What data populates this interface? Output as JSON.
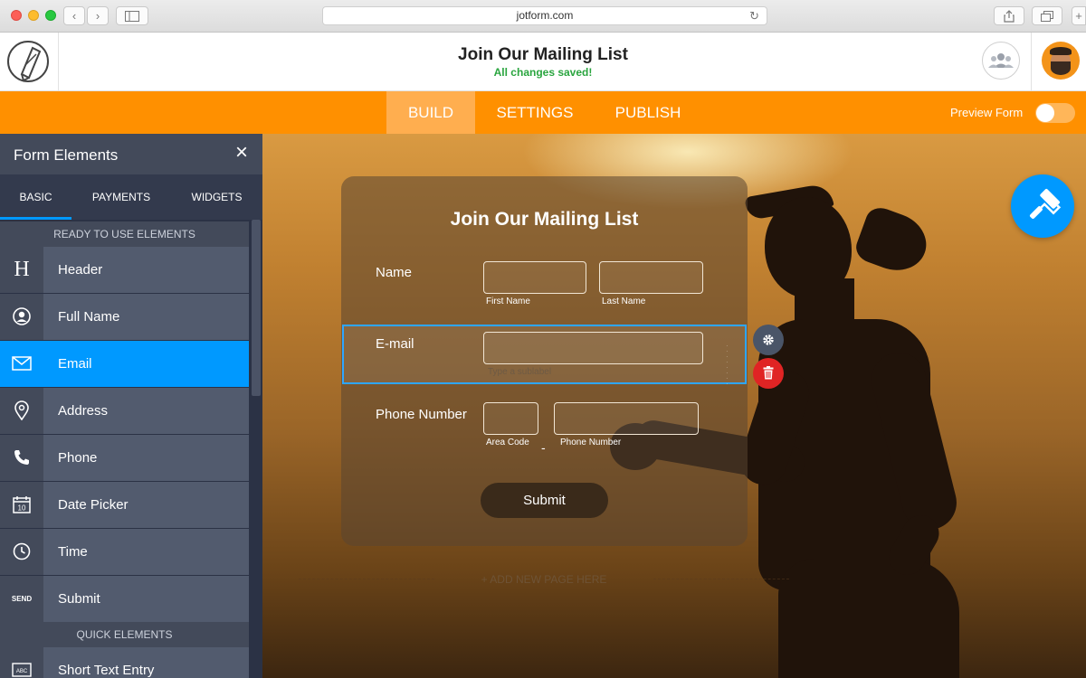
{
  "browser": {
    "url": "jotform.com"
  },
  "header": {
    "title": "Join Our Mailing List",
    "status": "All changes saved!"
  },
  "nav": {
    "tabs": [
      {
        "label": "BUILD"
      },
      {
        "label": "SETTINGS"
      },
      {
        "label": "PUBLISH"
      }
    ],
    "preview_label": "Preview Form"
  },
  "sidebar": {
    "title": "Form Elements",
    "tabs": [
      {
        "label": "BASIC"
      },
      {
        "label": "PAYMENTS"
      },
      {
        "label": "WIDGETS"
      }
    ],
    "section_ready": "READY TO USE ELEMENTS",
    "section_quick": "QUICK ELEMENTS",
    "items": [
      {
        "label": "Header",
        "icon": "header-icon"
      },
      {
        "label": "Full Name",
        "icon": "person-icon"
      },
      {
        "label": "Email",
        "icon": "envelope-icon"
      },
      {
        "label": "Address",
        "icon": "map-pin-icon"
      },
      {
        "label": "Phone",
        "icon": "phone-icon"
      },
      {
        "label": "Date Picker",
        "icon": "calendar-icon"
      },
      {
        "label": "Time",
        "icon": "clock-icon"
      },
      {
        "label": "Submit",
        "icon": "send-icon"
      },
      {
        "label": "Short Text Entry",
        "icon": "text-entry-icon"
      }
    ],
    "calendar_day": "10",
    "send_text": "SEND",
    "text_icon_text": "ABC"
  },
  "form": {
    "title": "Join Our Mailing List",
    "name_label": "Name",
    "first_name_sublabel": "First Name",
    "last_name_sublabel": "Last Name",
    "email_label": "E-mail",
    "email_sublabel_placeholder": "Type a sublabel",
    "phone_label": "Phone Number",
    "area_code_sublabel": "Area Code",
    "phone_number_sublabel": "Phone Number",
    "phone_dash": "-",
    "submit_label": "Submit",
    "add_page": "+ ADD NEW PAGE HERE"
  },
  "colors": {
    "accent_orange": "#ff9000",
    "accent_blue": "#0099ff",
    "saved_green": "#2aa53f",
    "delete_red": "#e02424"
  }
}
